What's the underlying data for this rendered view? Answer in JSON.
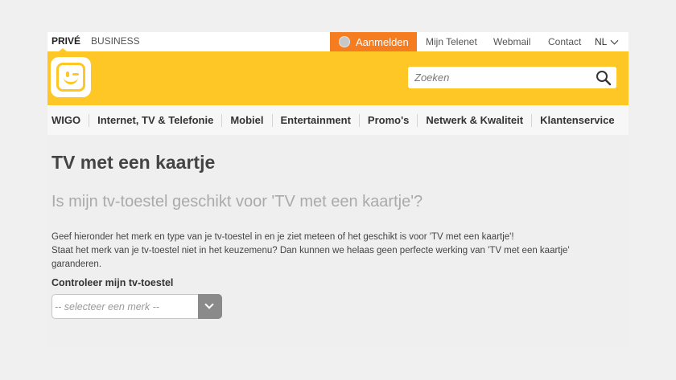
{
  "topbar": {
    "segments": [
      "PRIVÉ",
      "BUSINESS"
    ],
    "login_label": "Aanmelden",
    "links": [
      "Mijn Telenet",
      "Webmail",
      "Contact"
    ],
    "language": "NL"
  },
  "header": {
    "search": {
      "placeholder": "Zoeken"
    }
  },
  "nav": {
    "items": [
      "WIGO",
      "Internet, TV & Telefonie",
      "Mobiel",
      "Entertainment",
      "Promo's",
      "Netwerk & Kwaliteit",
      "Klantenservice"
    ]
  },
  "content": {
    "title": "TV met een kaartje",
    "subtitle": "Is mijn tv-toestel geschikt voor 'TV met een kaartje'?",
    "intro_line1": "Geef hieronder het merk en type van je tv-toestel in en je ziet meteen of het geschikt is voor 'TV met een kaartje'!",
    "intro_line2": "Staat het merk van je tv-toestel niet in het keuzemenu? Dan kunnen we helaas geen perfecte werking van 'TV met een kaartje' garanderen.",
    "check_label": "Controleer mijn tv-toestel",
    "select_value": "-- selecteer een merk --"
  },
  "colors": {
    "brand_yellow": "#ffc726",
    "login_orange": "#f57c1f",
    "select_button": "#8a8a8a"
  }
}
